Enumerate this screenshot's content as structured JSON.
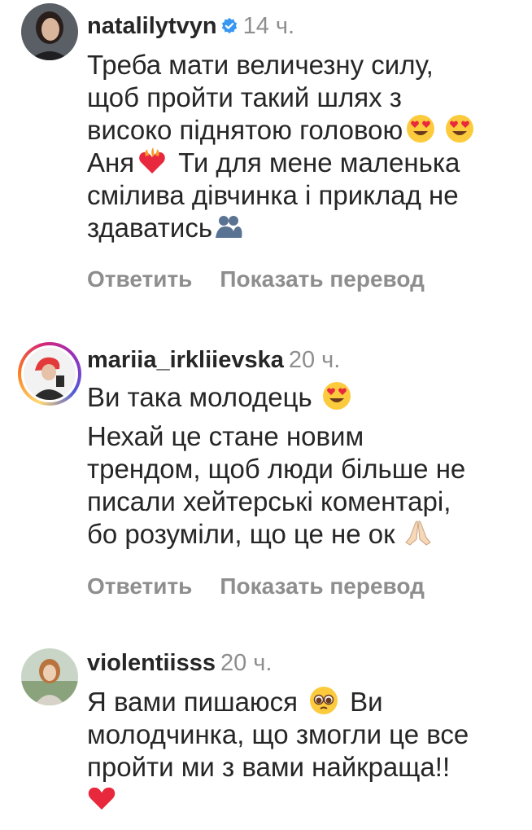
{
  "comments": [
    {
      "username": "natalilytvyn",
      "verified": true,
      "time": "14 ч.",
      "lines": [
        "Треба мати величезну силу,",
        "щоб пройти такий шлях з",
        "високо піднятою головою",
        "Аня",
        "Ти для мене маленька",
        "смілива дівчинка і приклад не",
        "здаватись"
      ],
      "reply_label": "Ответить",
      "translate_label": "Показать перевод",
      "emojis": [
        "heart-eyes-emoji",
        "heart-eyes-emoji",
        "heart-on-fire-emoji",
        "people-hugging-emoji"
      ]
    },
    {
      "username": "mariia_irkliievska",
      "verified": false,
      "time": "20 ч.",
      "lines": [
        "Ви така молодець",
        "Нехай це стане новим",
        "трендом, щоб люди більше не",
        "писали хейтерські коментарі,",
        "бо розуміли, що це не ок"
      ],
      "reply_label": "Ответить",
      "translate_label": "Показать перевод",
      "emojis": [
        "heart-eyes-emoji",
        "folded-hands-emoji"
      ]
    },
    {
      "username": "violentiisss",
      "verified": false,
      "time": "20 ч.",
      "lines": [
        "Я вами пишаюся",
        "Ви",
        "молодчинка, що змогли це все",
        "пройти ми з вами найкраща!!"
      ],
      "emojis": [
        "pleading-face-emoji",
        "red-heart-emoji"
      ]
    }
  ]
}
